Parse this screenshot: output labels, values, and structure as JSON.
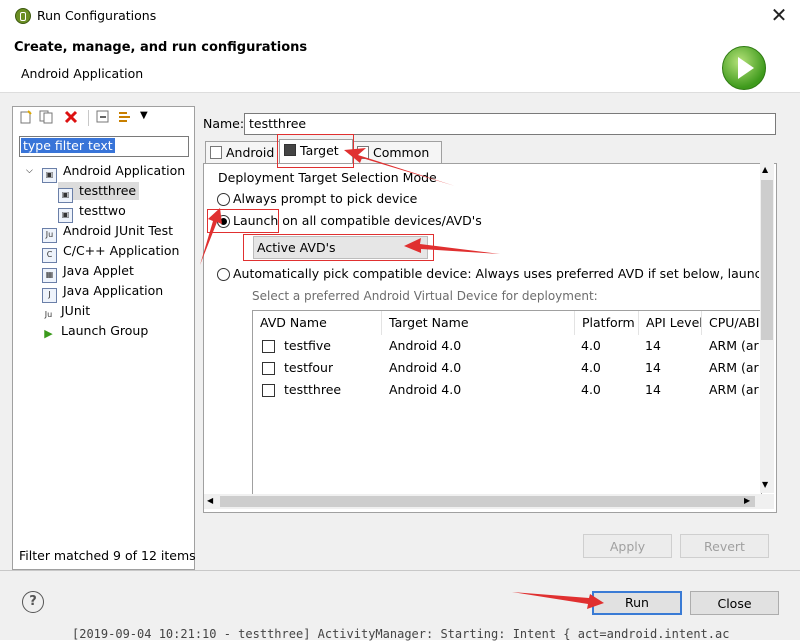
{
  "window": {
    "title": "Run Configurations"
  },
  "header": {
    "title": "Create, manage, and run configurations",
    "subtitle": "Android Application"
  },
  "left": {
    "filter_placeholder": "type filter text",
    "tree": [
      {
        "label": "Android Application",
        "expanded": true
      },
      {
        "label": "testthree",
        "selected": true
      },
      {
        "label": "testtwo"
      },
      {
        "label": "Android JUnit Test"
      },
      {
        "label": "C/C++ Application"
      },
      {
        "label": "Java Applet"
      },
      {
        "label": "Java Application"
      },
      {
        "label": "JUnit"
      },
      {
        "label": "Launch Group"
      }
    ],
    "status": "Filter matched 9 of 12 items"
  },
  "form": {
    "name_label": "Name:",
    "name_value": "testthree",
    "tabs": [
      {
        "label": "Android"
      },
      {
        "label": "Target",
        "active": true
      },
      {
        "label": "Common"
      }
    ],
    "section_title": "Deployment Target Selection Mode",
    "options": [
      {
        "label": "Always prompt to pick device",
        "selected": false
      },
      {
        "label": "Launch on all compatible devices/AVD's",
        "selected": true
      },
      {
        "label": "Automatically pick compatible device: Always uses preferred AVD if set below, launches on",
        "selected": false
      }
    ],
    "combo_value": "Active AVD's",
    "avd_hint": "Select a preferred Android Virtual Device for deployment:",
    "table": {
      "columns": [
        "AVD Name",
        "Target Name",
        "Platform",
        "API Level",
        "CPU/ABI"
      ],
      "rows": [
        [
          "testfive",
          "Android 4.0",
          "4.0",
          "14",
          "ARM (ar"
        ],
        [
          "testfour",
          "Android 4.0",
          "4.0",
          "14",
          "ARM (ar"
        ],
        [
          "testthree",
          "Android 4.0",
          "4.0",
          "14",
          "ARM (ar"
        ]
      ]
    }
  },
  "buttons": {
    "apply": "Apply",
    "revert": "Revert",
    "run": "Run",
    "close": "Close",
    "help": "?"
  },
  "console_line": "[2019-09-04 10:21:10 - testthree] ActivityManager: Starting: Intent { act=android.intent.ac",
  "colors": {
    "annotation": "#e03030",
    "selection": "#3874d8"
  }
}
